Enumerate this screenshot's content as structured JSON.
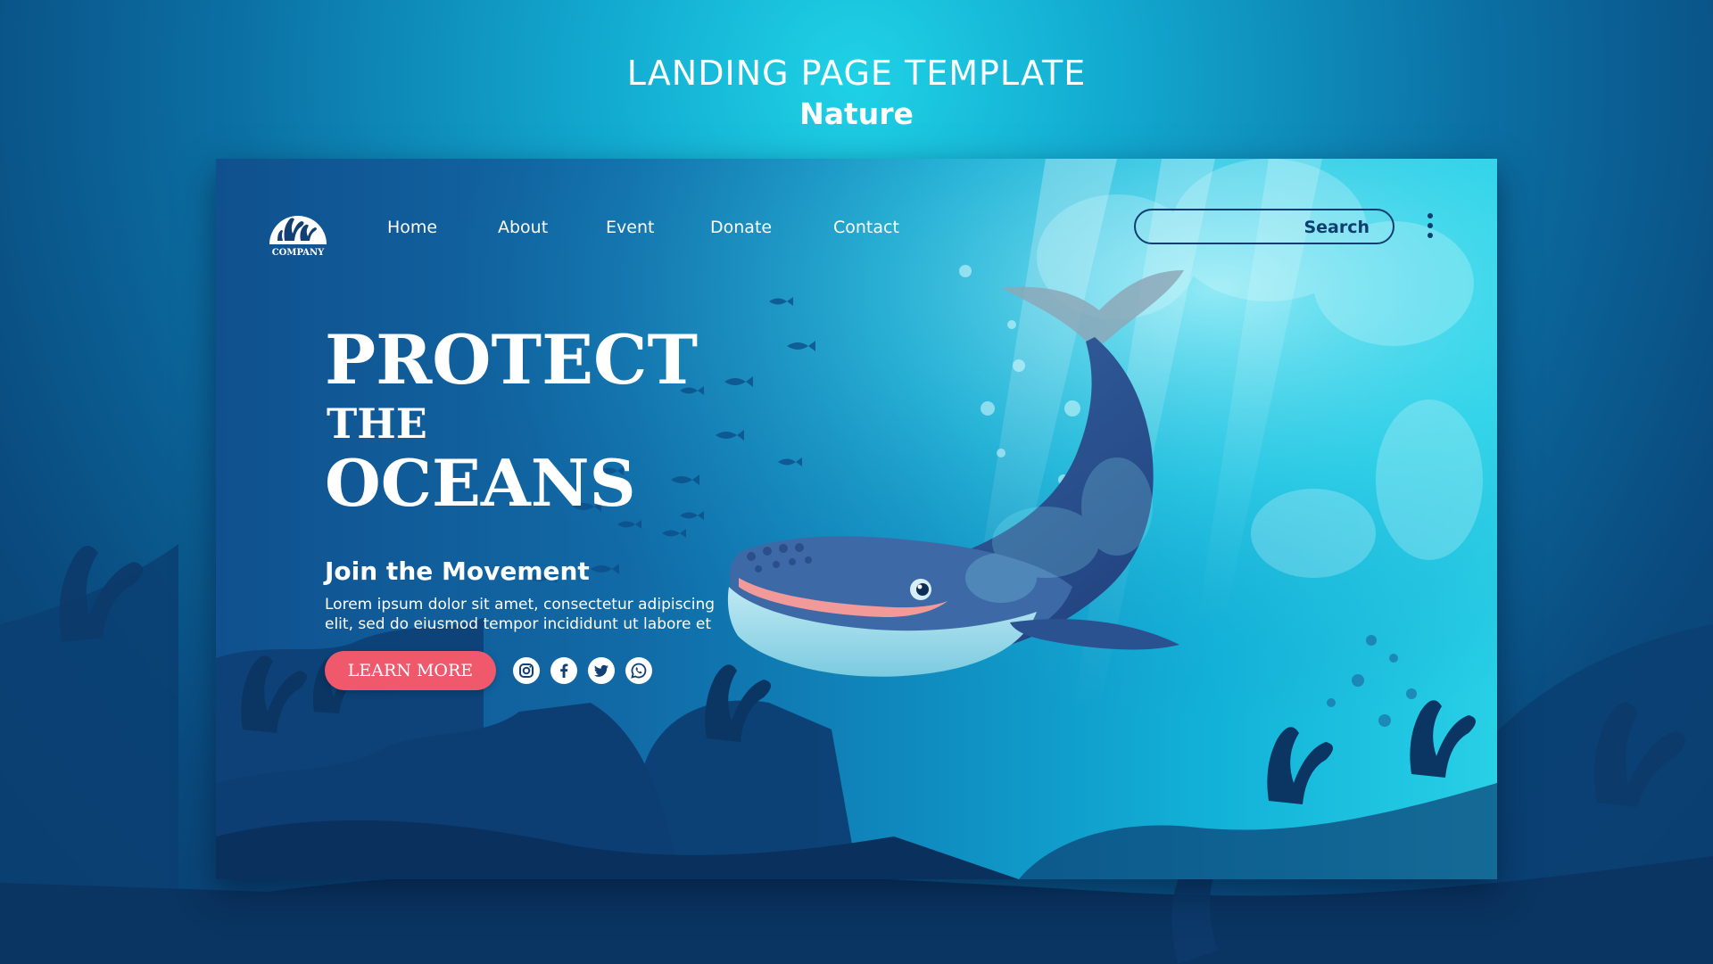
{
  "template_header": {
    "title": "LANDING PAGE TEMPLATE",
    "subtitle": "Nature"
  },
  "logo": {
    "text": "COMPANY",
    "icon": "coral-logo-icon"
  },
  "nav": {
    "items": [
      {
        "label": "Home"
      },
      {
        "label": "About"
      },
      {
        "label": "Event"
      },
      {
        "label": "Donate"
      },
      {
        "label": "Contact"
      }
    ]
  },
  "search": {
    "label": "Search"
  },
  "menu": {
    "icon": "kebab-menu-icon"
  },
  "hero": {
    "line1": "PROTECT",
    "line2": "THE",
    "line3": "OCEANS",
    "subheading": "Join the Movement",
    "body_line1": "Lorem ipsum dolor sit amet, consectetur adipiscing",
    "body_line2": "elit, sed do eiusmod tempor incididunt ut labore et",
    "cta_label": "LEARN MORE"
  },
  "social": [
    {
      "icon": "instagram-icon"
    },
    {
      "icon": "facebook-icon"
    },
    {
      "icon": "twitter-icon"
    },
    {
      "icon": "whatsapp-icon"
    }
  ],
  "colors": {
    "accent": "#f0586c",
    "nav_dark": "#0e3e70",
    "ocean_deep": "#10508e",
    "ocean_light": "#28d0e6"
  }
}
